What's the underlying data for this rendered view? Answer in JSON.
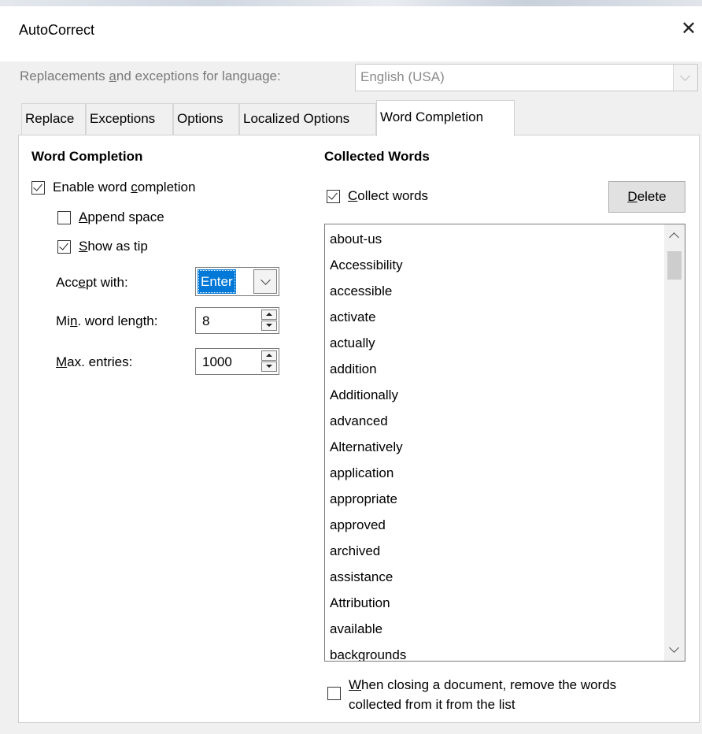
{
  "window": {
    "title": "AutoCorrect",
    "close_glyph": "✕"
  },
  "language": {
    "label_pre": "Replacements ",
    "label_u": "a",
    "label_post": "nd exceptions for language:",
    "value": "English (USA)"
  },
  "tabs": [
    {
      "label": "Replace"
    },
    {
      "label": "Exceptions"
    },
    {
      "label": "Options"
    },
    {
      "label": "Localized Options"
    },
    {
      "label": "Word Completion"
    }
  ],
  "word_completion": {
    "header": "Word Completion",
    "enable": {
      "pre": "Enable word ",
      "u": "c",
      "post": "ompletion",
      "checked": true
    },
    "append_space": {
      "pre": "",
      "u": "A",
      "post": "ppend space",
      "checked": false
    },
    "show_as_tip": {
      "pre": "",
      "u": "S",
      "post": "how as tip",
      "checked": true
    },
    "accept_with": {
      "pre": "Acc",
      "u": "e",
      "post": "pt with:",
      "value": "Enter"
    },
    "min_word_length": {
      "pre": "Mi",
      "u": "n",
      "post": ". word length:",
      "value": "8"
    },
    "max_entries": {
      "pre": "",
      "u": "M",
      "post": "ax. entries:",
      "value": "1000"
    }
  },
  "collected_words": {
    "header": "Collected Words",
    "collect": {
      "pre": "",
      "u": "C",
      "post": "ollect words",
      "checked": true
    },
    "delete": {
      "pre": "",
      "u": "D",
      "post": "elete"
    },
    "words": [
      "about-us",
      "Accessibility",
      "accessible",
      "activate",
      "actually",
      "addition",
      "Additionally",
      "advanced",
      "Alternatively",
      "application",
      "appropriate",
      "approved",
      "archived",
      "assistance",
      "Attribution",
      "available",
      "backgrounds"
    ],
    "remove_on_close": {
      "line1_u": "W",
      "line1_post": "hen closing a document, remove the words",
      "line2": "collected from it from the list",
      "checked": false
    }
  },
  "colors": {
    "selection": "#0078d7",
    "panel": "#ffffff",
    "dialog": "#f0f0f0",
    "disabled_text": "#7a7a7a"
  }
}
